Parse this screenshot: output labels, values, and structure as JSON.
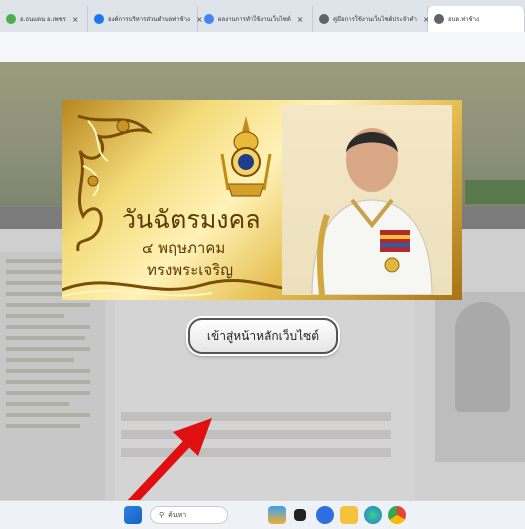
{
  "browser": {
    "tabs": [
      {
        "label": "อ.ธนแดน อ.เพชร",
        "favicon_color": "#4caf50",
        "active": false
      },
      {
        "label": "องค์การบริหารส่วนตำบลท่าช้าง",
        "favicon_color": "#1877f2",
        "active": false
      },
      {
        "label": "ผลงานการทำใช้งานเว็บไซต์",
        "favicon_color": "#4285f4",
        "active": false
      },
      {
        "label": "คู่มือการใช้งานเว็บไซต์ประจำตำ",
        "favicon_color": "#5f6368",
        "active": false
      },
      {
        "label": "อบต.ท่าช้าง",
        "favicon_color": "#5f6368",
        "active": true
      }
    ],
    "tab_close_glyph": "×"
  },
  "popup": {
    "title": "วันฉัตรมงคล",
    "date_line": "๔ พฤษภาคม",
    "royal_line": "ทรงพระเจริญ",
    "enter_button_label": "เข้าสู่หน้าหลักเว็บไซต์"
  },
  "taskbar": {
    "search_placeholder": "ค้นหา",
    "icons": [
      "windows-start-icon",
      "search-icon",
      "widgets-icon",
      "file-explorer-icon",
      "zoom-icon",
      "folder-icon",
      "edge-icon",
      "chrome-icon"
    ]
  },
  "colors": {
    "gold_dark": "#a77414",
    "gold_light": "#fff2b8",
    "text_brown": "#5b3a05",
    "arrow_red": "#e01010"
  }
}
